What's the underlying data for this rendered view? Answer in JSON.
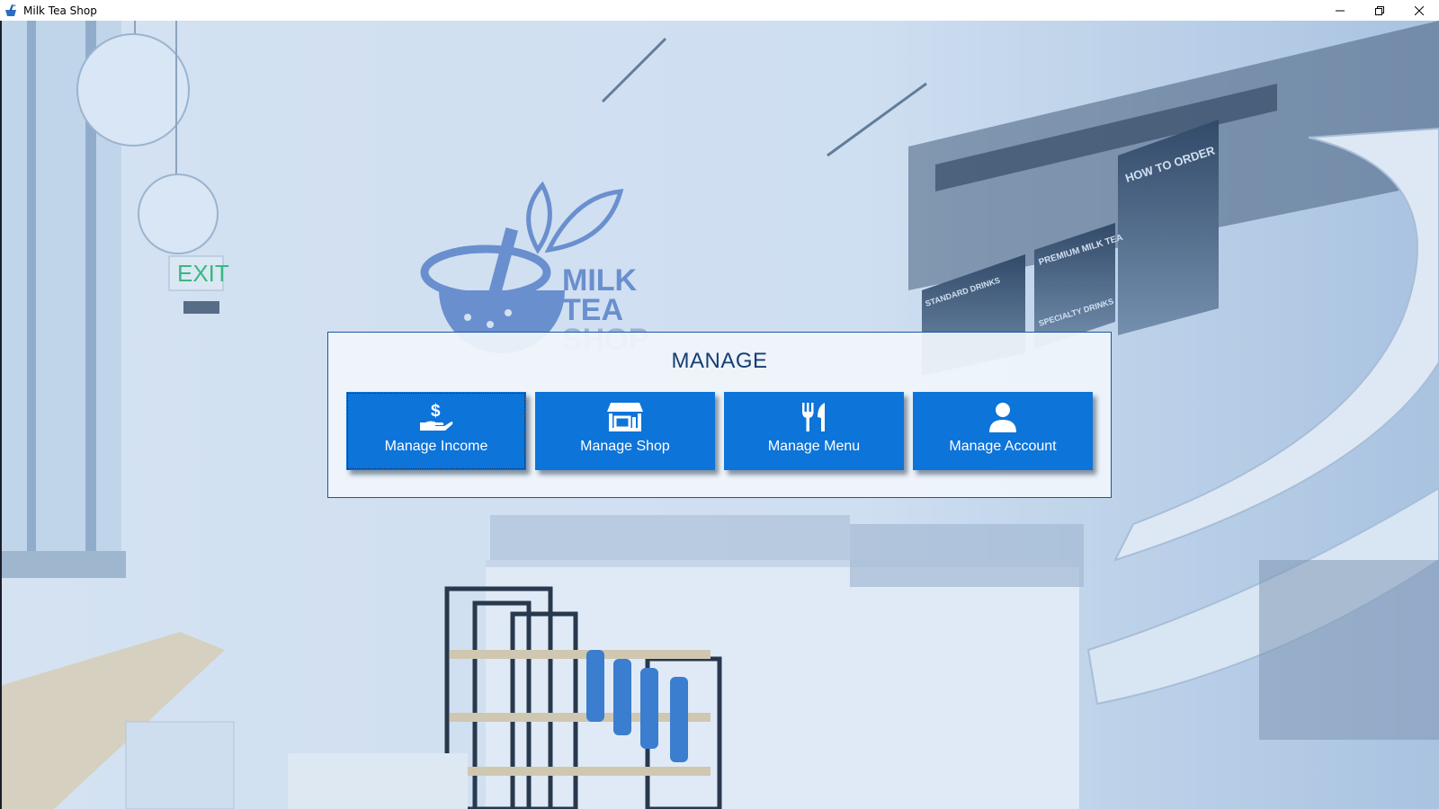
{
  "window": {
    "title": "Milk Tea Shop",
    "app_icon": "milk-tea-icon",
    "controls": [
      "minimize-icon",
      "restore-icon",
      "close-icon"
    ]
  },
  "background": {
    "logo_lines": [
      "MILK",
      "TEA",
      "SHOP"
    ],
    "exit_sign": "EXIT",
    "menu_boards": [
      "HOW TO ORDER",
      "PREMIUM MILK TEA",
      "STANDARD DRINKS",
      "SPECIALTY DRINKS"
    ]
  },
  "manage": {
    "title": "MANAGE",
    "buttons": [
      {
        "label": "Manage Income",
        "icon": "hand-dollar-icon"
      },
      {
        "label": "Manage Shop",
        "icon": "store-icon"
      },
      {
        "label": "Manage Menu",
        "icon": "fork-knife-icon"
      },
      {
        "label": "Manage Account",
        "icon": "user-icon"
      }
    ]
  },
  "colors": {
    "accent": "#0d74d9",
    "title_text": "#163e74",
    "panel_border": "#1b57a0"
  }
}
